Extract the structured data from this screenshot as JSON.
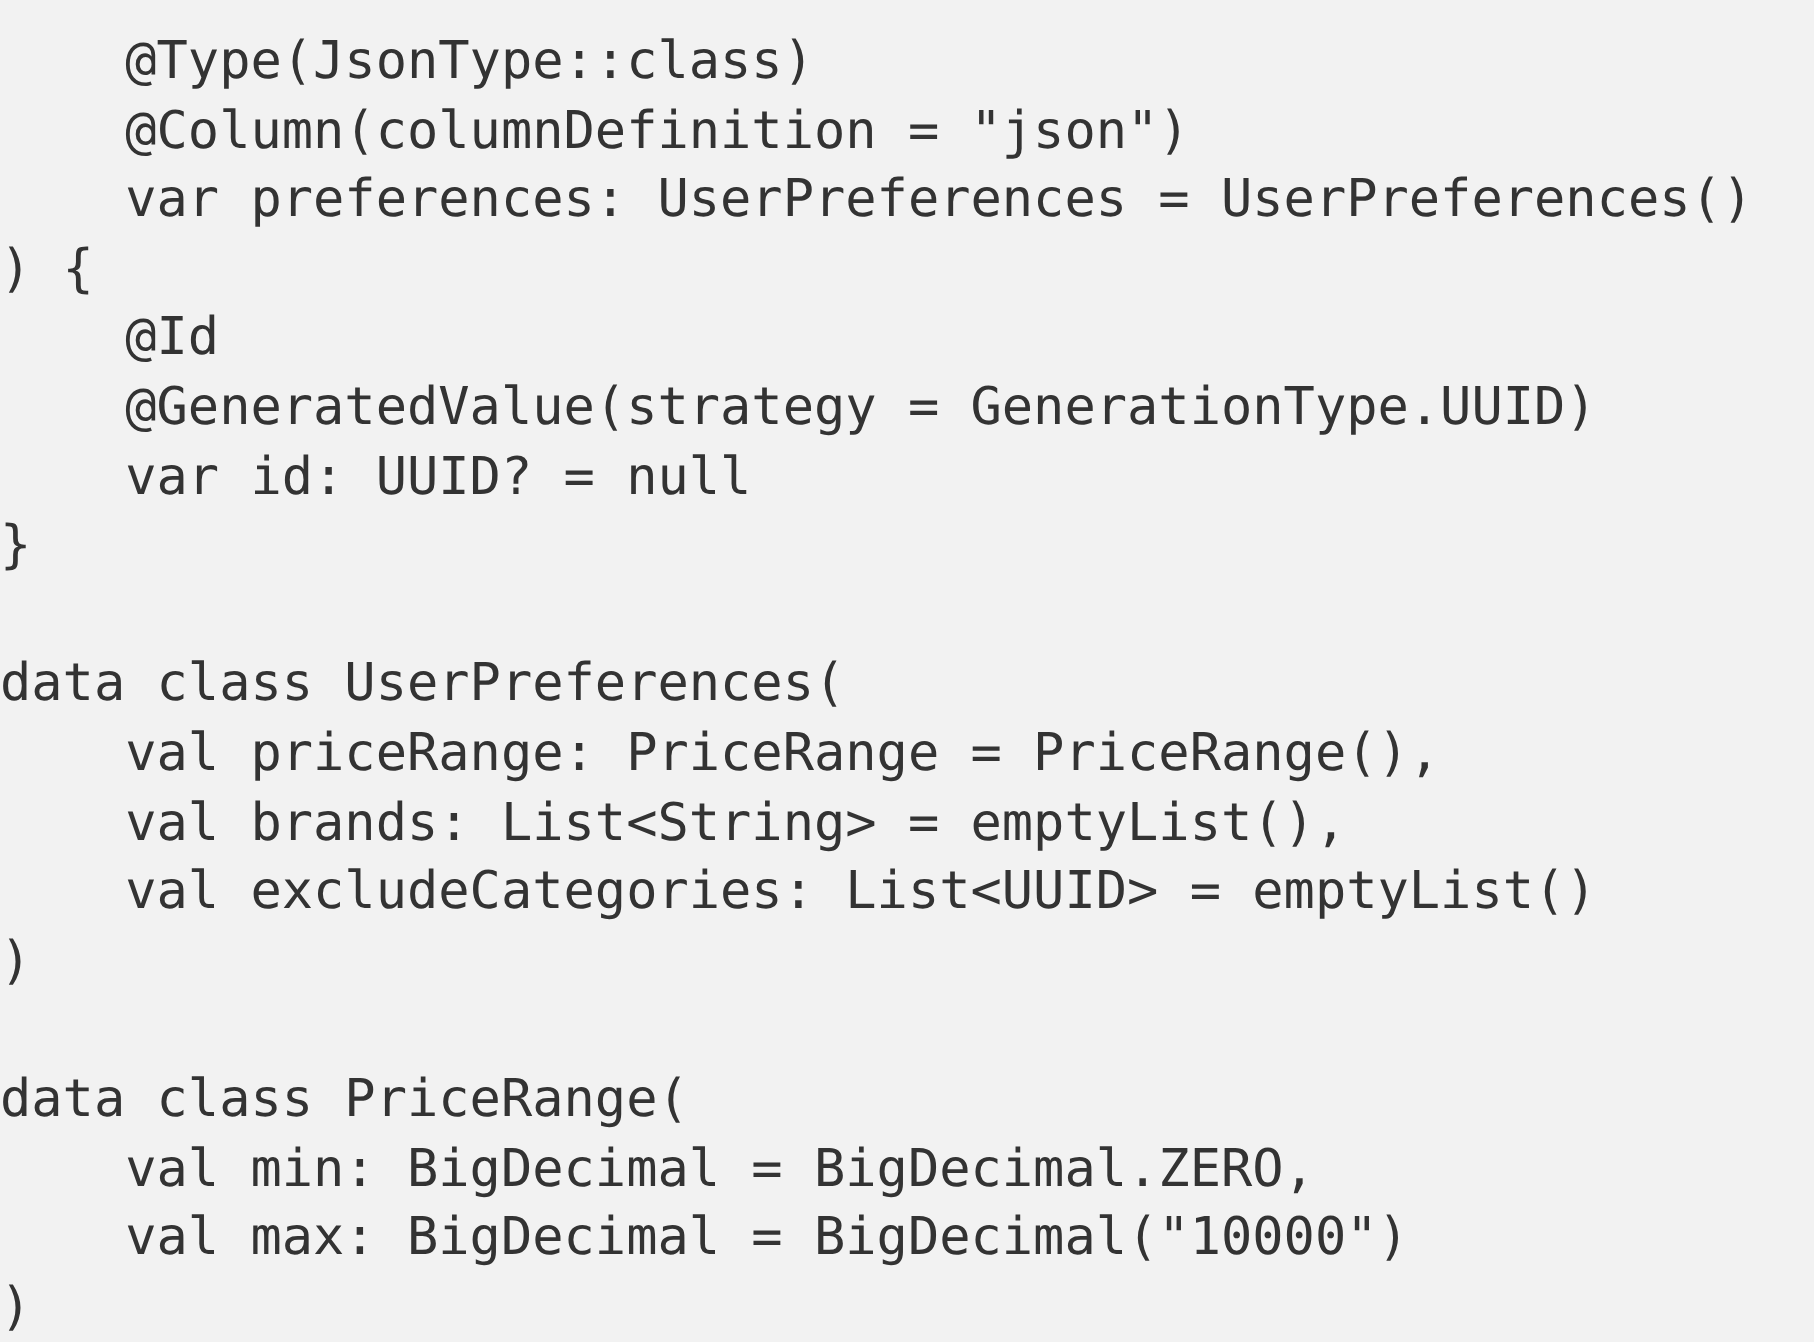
{
  "code_blocks": [
    {
      "lines": [
        "    @Type(JsonType::class)",
        "    @Column(columnDefinition = \"json\")",
        "    var preferences: UserPreferences = UserPreferences()",
        ") {",
        "    @Id",
        "    @GeneratedValue(strategy = GenerationType.UUID)",
        "    var id: UUID? = null",
        "}"
      ]
    },
    {
      "lines": [
        "data class UserPreferences(",
        "    val priceRange: PriceRange = PriceRange(),",
        "    val brands: List<String> = emptyList(),",
        "    val excludeCategories: List<UUID> = emptyList()",
        ")"
      ]
    },
    {
      "lines": [
        "data class PriceRange(",
        "    val min: BigDecimal = BigDecimal.ZERO,",
        "    val max: BigDecimal = BigDecimal(\"10000\")",
        ")"
      ]
    }
  ]
}
